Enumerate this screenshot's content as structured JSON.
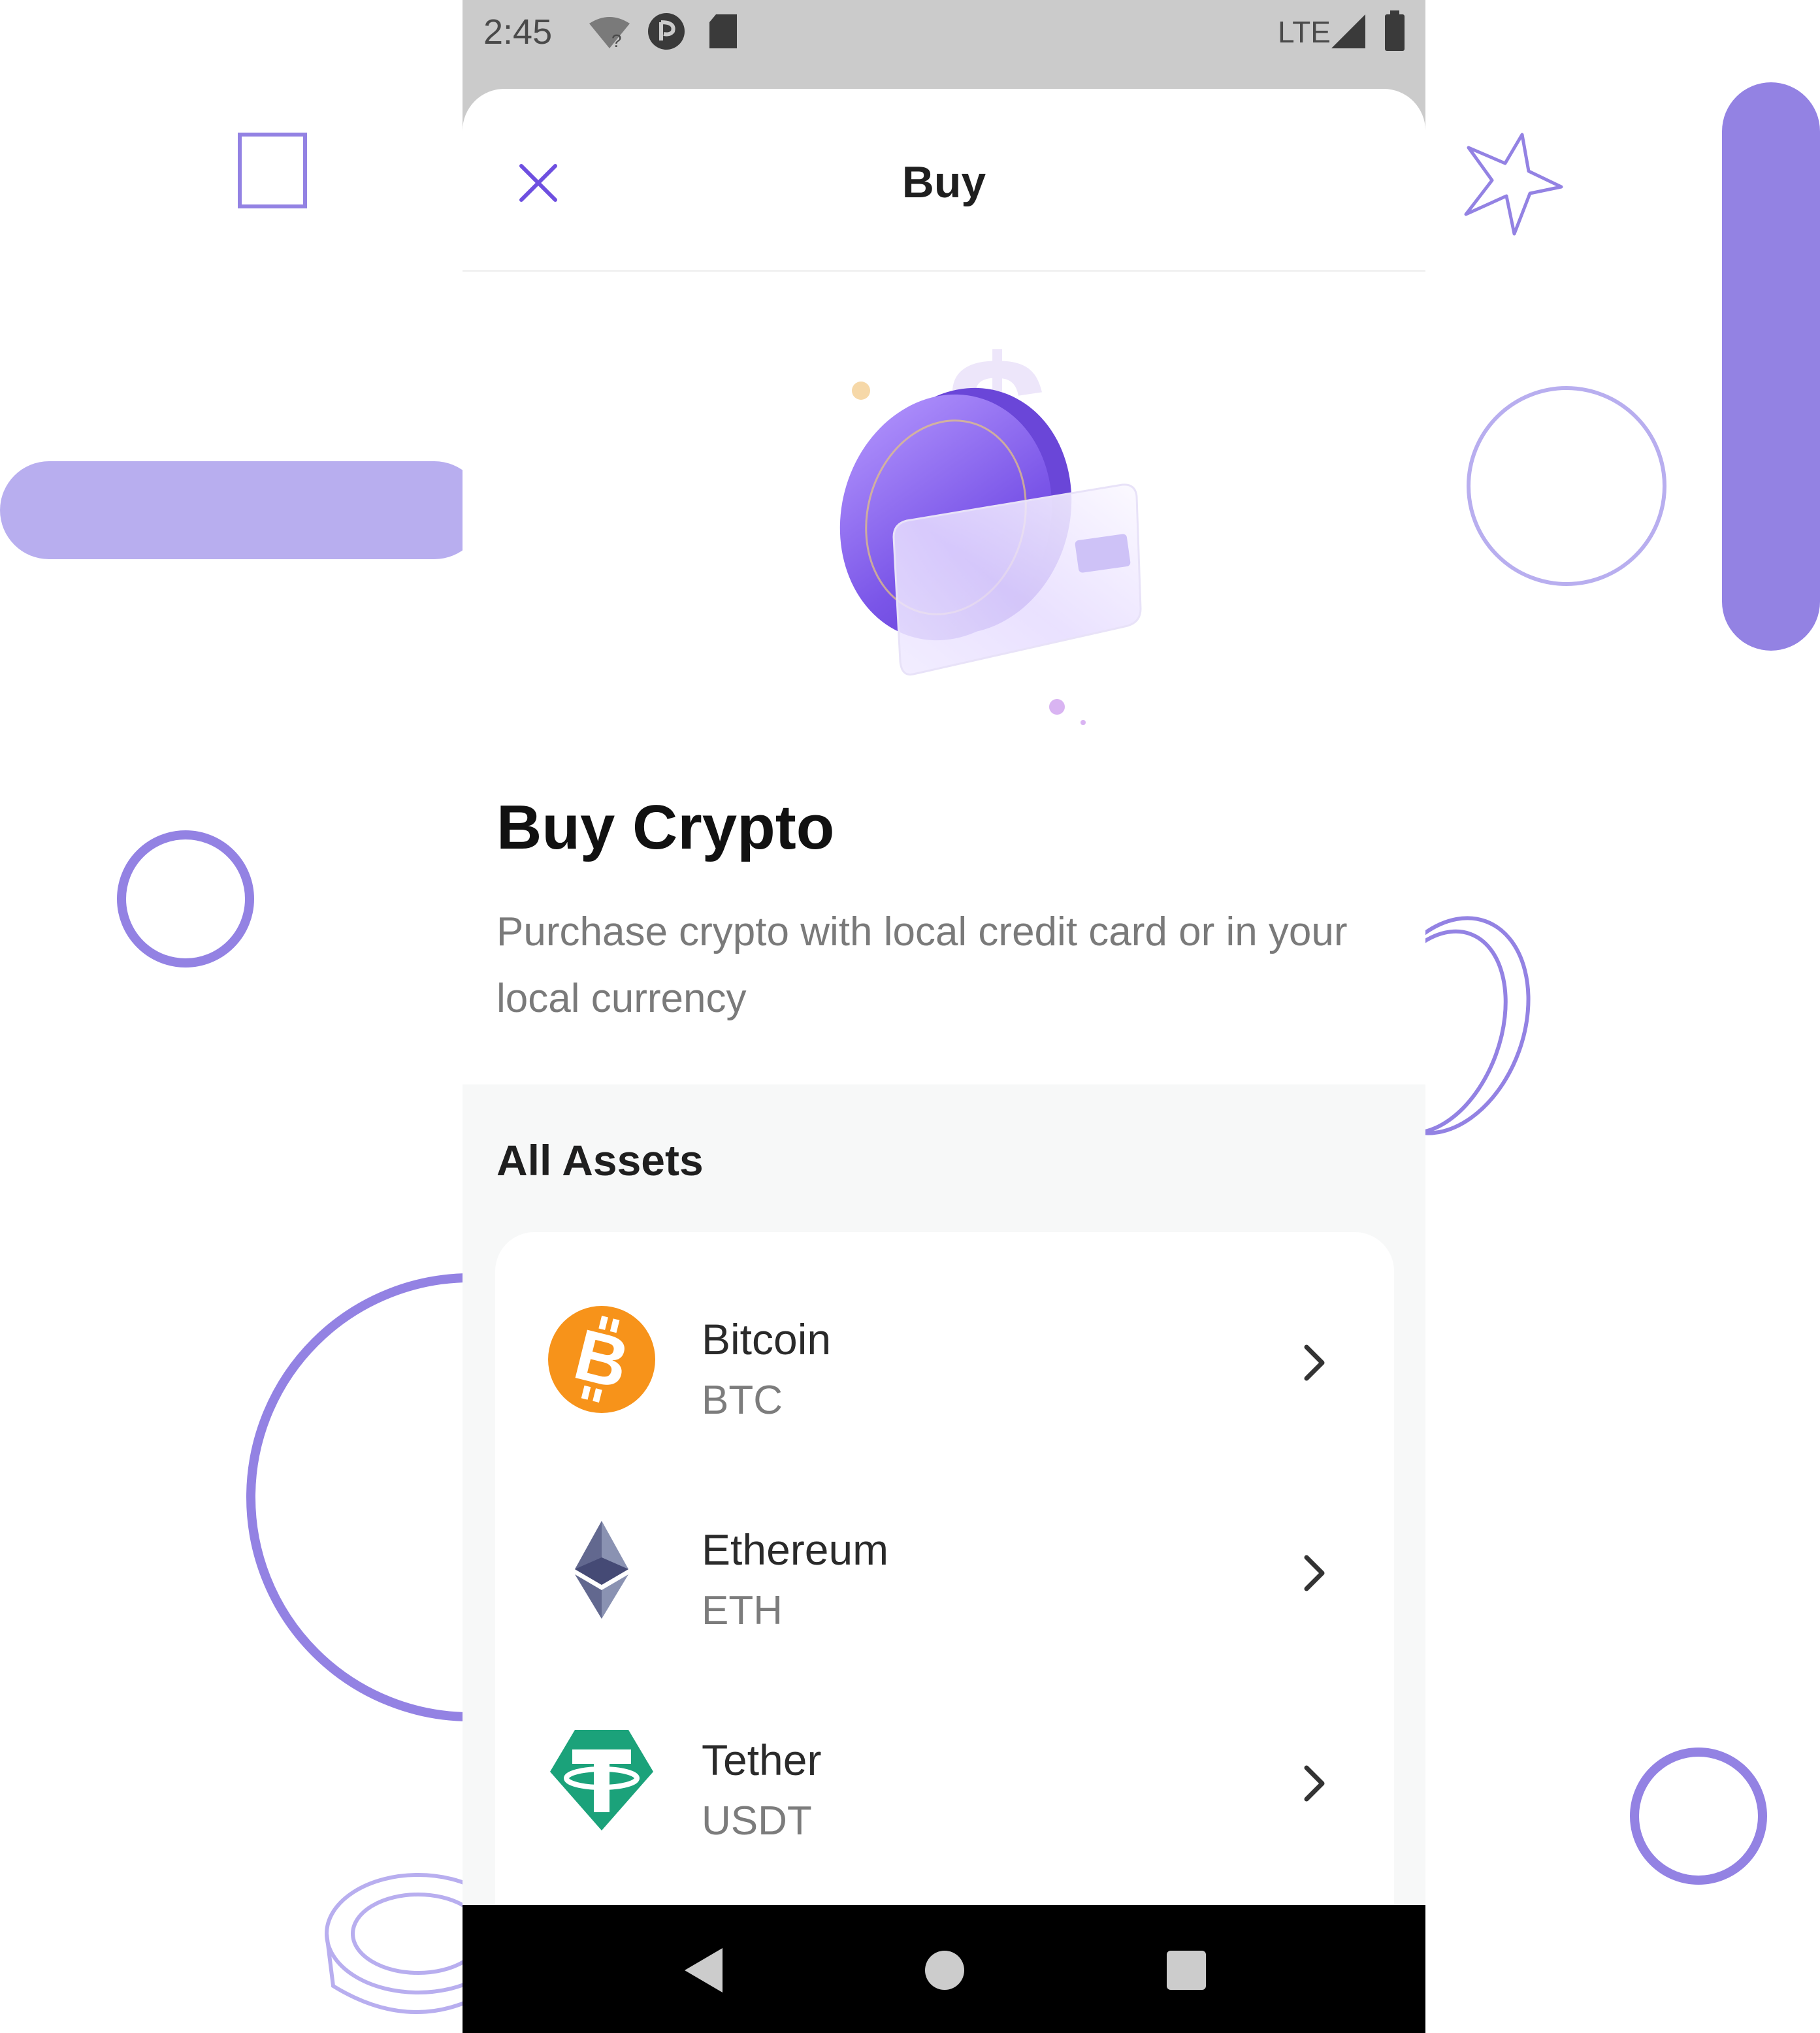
{
  "status_bar": {
    "time": "2:45",
    "network": "LTE",
    "icons": [
      "wifi-unknown-icon",
      "app-notification-icon",
      "sd-card-icon",
      "signal-icon",
      "battery-icon"
    ]
  },
  "header": {
    "title": "Buy",
    "close_icon": "close-icon"
  },
  "hero": {
    "illustration": "coin-and-card-illustration"
  },
  "intro": {
    "headline": "Buy Crypto",
    "description": "Purchase crypto with local credit card or in your local currency"
  },
  "assets": {
    "heading": "All Assets",
    "items": [
      {
        "name": "Bitcoin",
        "symbol": "BTC",
        "icon": "bitcoin-icon",
        "color": "#F7931A"
      },
      {
        "name": "Ethereum",
        "symbol": "ETH",
        "icon": "ethereum-icon",
        "color": "#627EEA"
      },
      {
        "name": "Tether",
        "symbol": "USDT",
        "icon": "tether-icon",
        "color": "#1BA27A"
      }
    ]
  },
  "navigation": {
    "buttons": [
      "back-icon",
      "home-icon",
      "recents-icon"
    ]
  },
  "colors": {
    "accent": "#6E4FE0",
    "decor": "#9382E3",
    "decor_light": "#B8AEEF"
  }
}
